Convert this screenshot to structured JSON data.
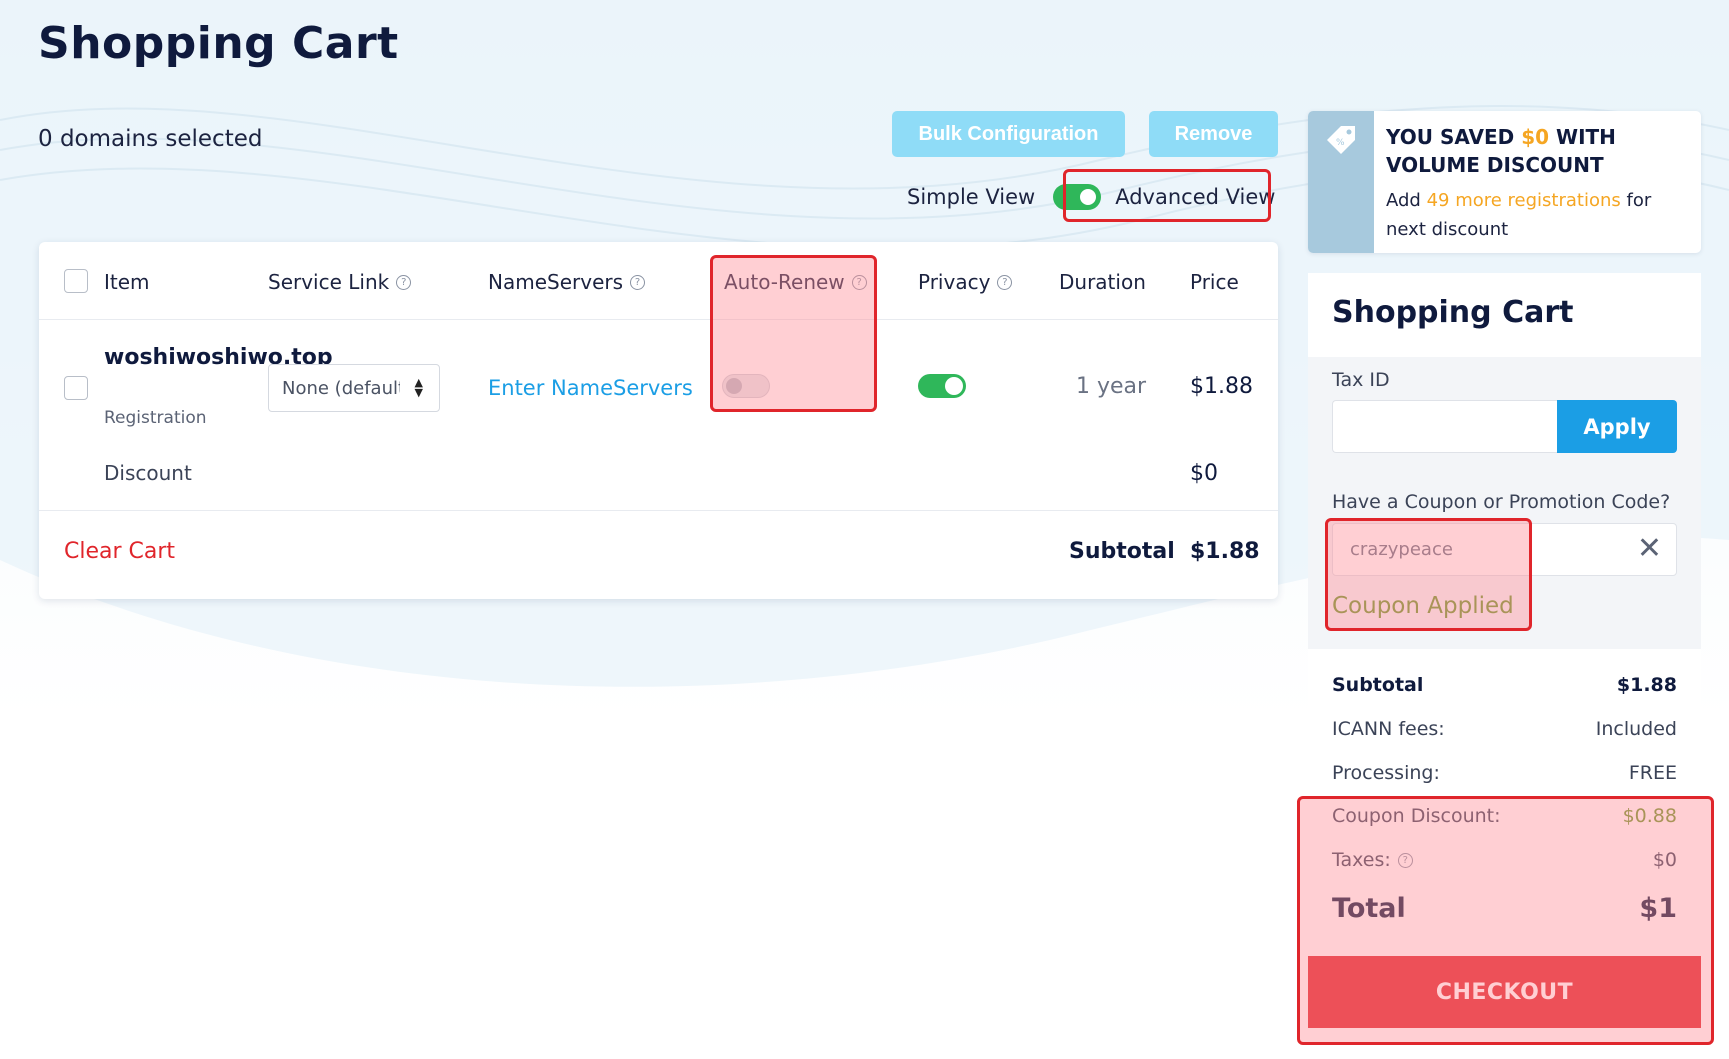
{
  "page": {
    "title": "Shopping Cart",
    "selected_count": "0 domains selected"
  },
  "toolbar": {
    "bulk_label": "Bulk Configuration",
    "remove_label": "Remove",
    "simple_view_label": "Simple View",
    "advanced_view_label": "Advanced View"
  },
  "table": {
    "headers": {
      "item": "Item",
      "service_link": "Service Link",
      "nameservers": "NameServers",
      "auto_renew": "Auto-Renew",
      "privacy": "Privacy",
      "duration": "Duration",
      "price": "Price"
    },
    "row": {
      "domain": "woshiwoshiwo.top",
      "type": "Registration",
      "service_link_value": "None (default)",
      "nameservers_link": "Enter NameServers",
      "auto_renew": false,
      "privacy": true,
      "duration": "1 year",
      "price": "$1.88"
    },
    "discount_label": "Discount",
    "discount_value": "$0",
    "clear_cart_label": "Clear Cart",
    "subtotal_label": "Subtotal",
    "subtotal_value": "$1.88"
  },
  "volume_banner": {
    "headline_prefix": "YOU SAVED ",
    "saved_amount": "$0",
    "headline_suffix": " WITH VOLUME DISCOUNT",
    "sub_prefix": "Add ",
    "sub_highlight": "49 more registrations",
    "sub_suffix": " for next discount"
  },
  "summary": {
    "title": "Shopping Cart",
    "tax_label": "Tax ID",
    "tax_value": "",
    "apply_label": "Apply",
    "coupon_label": "Have a Coupon or Promotion Code?",
    "coupon_value": "crazypeace",
    "coupon_status": "Coupon Applied",
    "rows": {
      "subtotal_label": "Subtotal",
      "subtotal_value": "$1.88",
      "icann_label": "ICANN fees:",
      "icann_value": "Included",
      "processing_label": "Processing:",
      "processing_value": "FREE",
      "coupon_discount_label": "Coupon Discount:",
      "coupon_discount_value": "$0.88",
      "taxes_label": "Taxes:",
      "taxes_value": "$0",
      "total_label": "Total",
      "total_value": "$1"
    },
    "checkout_label": "CHECKOUT"
  },
  "colors": {
    "accent_blue": "#1b9ee5",
    "danger_red": "#e0252b",
    "toggle_green": "#2fb75a",
    "highlight_orange": "#f5a623",
    "coupon_green": "#6b9a2c"
  },
  "icons": [
    "tag-icon",
    "help-icon",
    "close-icon",
    "select-arrows-icon"
  ]
}
